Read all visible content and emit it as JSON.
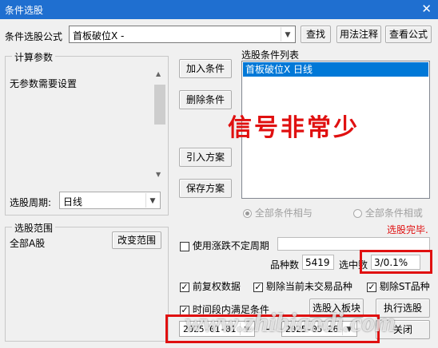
{
  "window": {
    "title": "条件选股",
    "close_glyph": "✕"
  },
  "formula": {
    "label": "条件选股公式",
    "value": "首板破位X  -",
    "find": "查找",
    "usage": "用法注释",
    "view": "查看公式"
  },
  "params": {
    "legend": "计算参数",
    "text": "无参数需要设置",
    "period_label": "选股周期:",
    "period_value": "日线"
  },
  "actions": {
    "add": "加入条件",
    "delete": "删除条件",
    "import": "引入方案",
    "save": "保存方案"
  },
  "conditions": {
    "legend": "选股条件列表",
    "items": [
      "首板破位X  日线"
    ]
  },
  "overlay": {
    "signal": "信号非常少"
  },
  "logic": {
    "and": "全部条件相与",
    "or": "全部条件相或"
  },
  "status": {
    "done": "选股完毕."
  },
  "range": {
    "legend": "选股范围",
    "value": "全部A股",
    "change": "改变范围"
  },
  "options": {
    "limit_period": "使用涨跌不定周期",
    "count_label": "品种数",
    "count_value": "5419",
    "selected_label": "选中数",
    "selected_value": "3/0.1%",
    "fq": "前复权数据",
    "exclude_untraded": "剔除当前未交易品种",
    "exclude_st": "剔除ST品种",
    "period_satisfy": "时间段内满足条件"
  },
  "dates": {
    "start": "2025-01-01",
    "sep": "-",
    "end": "2025-05-26"
  },
  "bottom": {
    "to_block": "选股入板块",
    "run": "执行选股",
    "close": "关闭"
  },
  "watermark": "www.zhibiaodi.com",
  "colors": {
    "title_bg": "#1f6fd0",
    "highlight": "#e01010",
    "selection": "#0078d7",
    "status": "#e01010"
  }
}
